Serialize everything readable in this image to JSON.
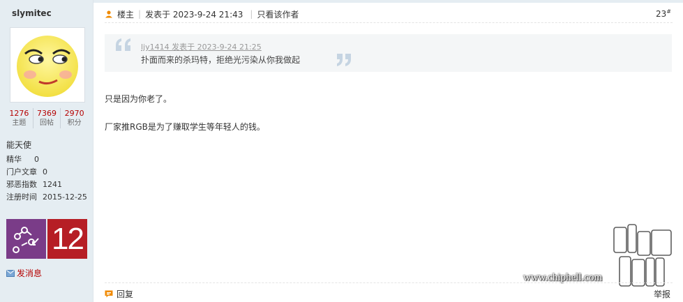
{
  "author": {
    "name": "slymitec",
    "stats": [
      {
        "value": "1276",
        "label": "主题"
      },
      {
        "value": "7369",
        "label": "回帖"
      },
      {
        "value": "2970",
        "label": "积分"
      }
    ],
    "group": "能天使",
    "info": [
      {
        "key": "精华",
        "value": "0"
      },
      {
        "key": "门户文章",
        "value": "0"
      },
      {
        "key": "邪恶指数",
        "value": "1241"
      },
      {
        "key": "注册时间",
        "value": "2015-12-25"
      }
    ],
    "medal_number": "12",
    "pm_label": "发消息"
  },
  "post": {
    "op_label": "楼主",
    "posted": "发表于 2023-9-24 21:43",
    "only_author": "只看该作者",
    "floor": "23",
    "floor_mark": "#",
    "quote": {
      "meta": "ljy1414 发表于 2023-9-24 21:25",
      "text": "扑面而来的杀玛特，拒绝光污染从你我做起"
    },
    "body_line1": "只是因为你老了。",
    "body_line2": "厂家推RGB是为了赚取学生等年轻人的钱。",
    "reply_label": "回复",
    "report_label": "举报"
  },
  "watermark": {
    "url": "www.chiphell.com"
  },
  "colors": {
    "accent_red": "#b50000",
    "sidebar_bg": "#e5edf2",
    "orange_icon": "#f08a00"
  }
}
